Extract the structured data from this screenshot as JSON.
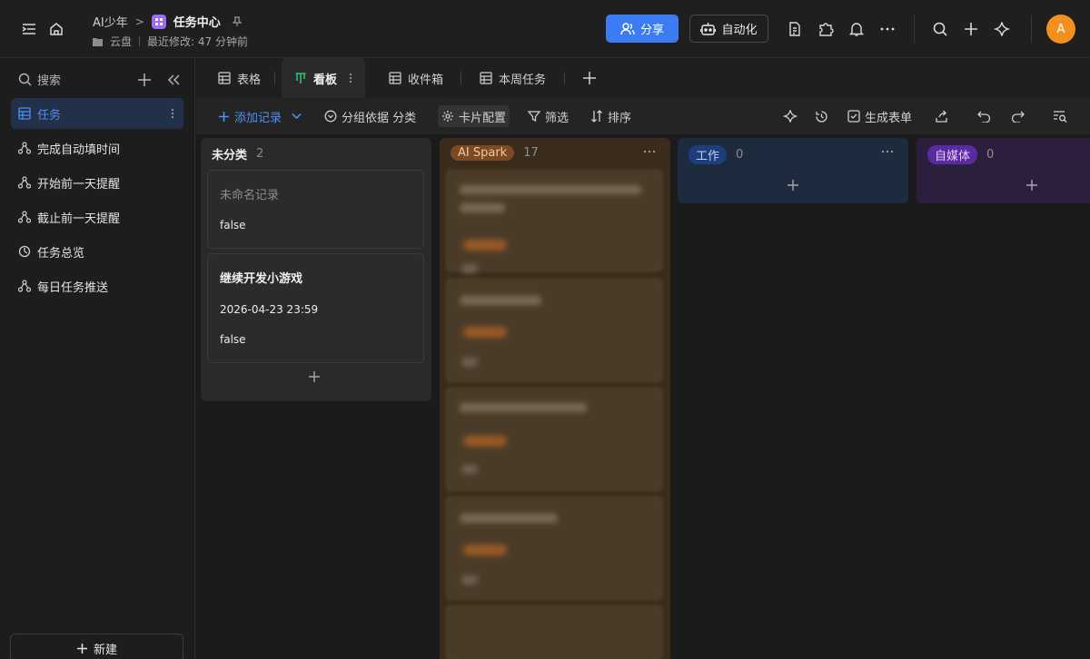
{
  "breadcrumb": {
    "parent": "AI少年",
    "title": "任务中心"
  },
  "meta": {
    "location": "云盘",
    "modified": "最近修改: 47 分钟前"
  },
  "header": {
    "share_label": "分享",
    "automation_label": "自动化",
    "avatar_letter": "A"
  },
  "colors": {
    "accent": "#3b7cf2",
    "avatar": "#f5901e",
    "app_badge": "#9b6cf6"
  },
  "sidebar": {
    "search_label": "搜索",
    "items": [
      {
        "label": "任务",
        "icon": "grid-table-icon"
      },
      {
        "label": "完成自动填时间",
        "icon": "workflow-icon"
      },
      {
        "label": "开始前一天提醒",
        "icon": "workflow-icon"
      },
      {
        "label": "截止前一天提醒",
        "icon": "workflow-icon"
      },
      {
        "label": "任务总览",
        "icon": "dashboard-icon"
      },
      {
        "label": "每日任务推送",
        "icon": "workflow-icon"
      }
    ],
    "new_label": "新建"
  },
  "tabs": [
    {
      "label": "表格",
      "icon": "table-icon"
    },
    {
      "label": "看板",
      "icon": "kanban-icon",
      "active": true
    },
    {
      "label": "收件箱",
      "icon": "table-icon"
    },
    {
      "label": "本周任务",
      "icon": "table-icon"
    }
  ],
  "toolbar": {
    "add_record": "添加记录",
    "group_by": "分组依据 分类",
    "card_config": "卡片配置",
    "filter": "筛选",
    "sort": "排序",
    "gen_form": "生成表单"
  },
  "board": {
    "columns": [
      {
        "name": "未分类",
        "count": "2",
        "cards": [
          {
            "title": "未命名记录",
            "field": "false"
          },
          {
            "title": "继续开发小游戏",
            "date": "2026-04-23  23:59",
            "field": "false"
          }
        ]
      },
      {
        "name": "AI Spark",
        "count": "17",
        "tag_bg": "#7a4a25",
        "tag_fg": "#f2c8a0"
      },
      {
        "name": "工作",
        "count": "0",
        "tag_bg": "#1d3e7a",
        "tag_fg": "#bcd3ff"
      },
      {
        "name": "自媒体",
        "count": "0",
        "tag_bg": "#5a2aa0",
        "tag_fg": "#e1ccff"
      }
    ]
  }
}
